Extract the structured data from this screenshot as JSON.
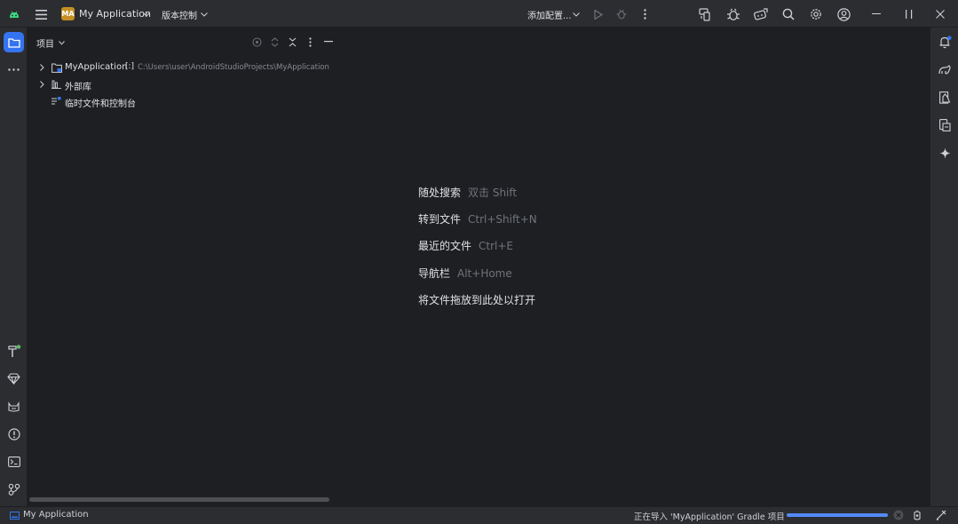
{
  "titlebar": {
    "project_badge": "MA",
    "project_name": "My Application",
    "vcs_menu": "版本控制",
    "run_config": "添加配置..."
  },
  "project_panel": {
    "title": "项目",
    "tree": [
      {
        "label": "MyApplication",
        "tag": "[:]",
        "path": "C:\\Users\\user\\AndroidStudioProjects\\MyApplication"
      },
      {
        "label": "外部库"
      },
      {
        "label": "临时文件和控制台"
      }
    ]
  },
  "editor_hints": [
    {
      "label": "随处搜索",
      "shortcut": "双击 Shift"
    },
    {
      "label": "转到文件",
      "shortcut": "Ctrl+Shift+N"
    },
    {
      "label": "最近的文件",
      "shortcut": "Ctrl+E"
    },
    {
      "label": "导航栏",
      "shortcut": "Alt+Home"
    },
    {
      "label": "将文件拖放到此处以打开",
      "shortcut": ""
    }
  ],
  "statusbar": {
    "breadcrumb": "My Application",
    "task_text": "正在导入 'MyApplication' Gradle 项目",
    "progress": 1.0
  },
  "colors": {
    "accent": "#3574f0",
    "background": "#1e1f22",
    "chrome": "#2b2d30",
    "badge": "#c69026",
    "notification_dot": "#5fb865"
  },
  "icons": {
    "top": [
      "android-logo-icon",
      "main-menu-icon",
      "chevron-down-icon",
      "run-icon",
      "debug-icon",
      "more-icon",
      "device-manager-icon",
      "bug-icon",
      "emulator-icon",
      "search-icon",
      "settings-icon",
      "account-icon",
      "minimize-icon",
      "restore-icon",
      "close-icon"
    ],
    "left": [
      "project-folder-icon",
      "more-tools-icon",
      "build-icon",
      "gem-icon",
      "logcat-icon",
      "problems-icon",
      "terminal-icon",
      "version-control-icon"
    ],
    "right": [
      "notifications-icon",
      "gradle-icon",
      "test-icon",
      "device-explorer-icon",
      "gemini-icon"
    ]
  }
}
